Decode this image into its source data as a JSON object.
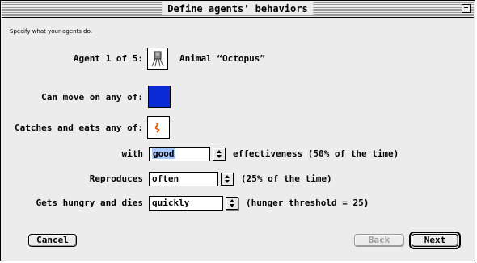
{
  "window": {
    "title": "Define agents' behaviors"
  },
  "instruction": "Specify what your agents do.",
  "agent": {
    "label": "Agent 1 of 5:",
    "name": "Animal “Octopus”"
  },
  "move": {
    "label": "Can move on any of:",
    "color": "#0a2bd6"
  },
  "catches": {
    "label": "Catches and eats any of:"
  },
  "effectiveness": {
    "prefix": "with",
    "value": "good",
    "suffix": "effectiveness (50% of the time)"
  },
  "reproduces": {
    "label": "Reproduces",
    "value": "often",
    "suffix": "(25% of the time)"
  },
  "hunger": {
    "label": "Gets hungry and dies",
    "value": "quickly",
    "suffix": "(hunger threshold = 25)"
  },
  "buttons": {
    "cancel": "Cancel",
    "back": "Back",
    "next": "Next"
  }
}
